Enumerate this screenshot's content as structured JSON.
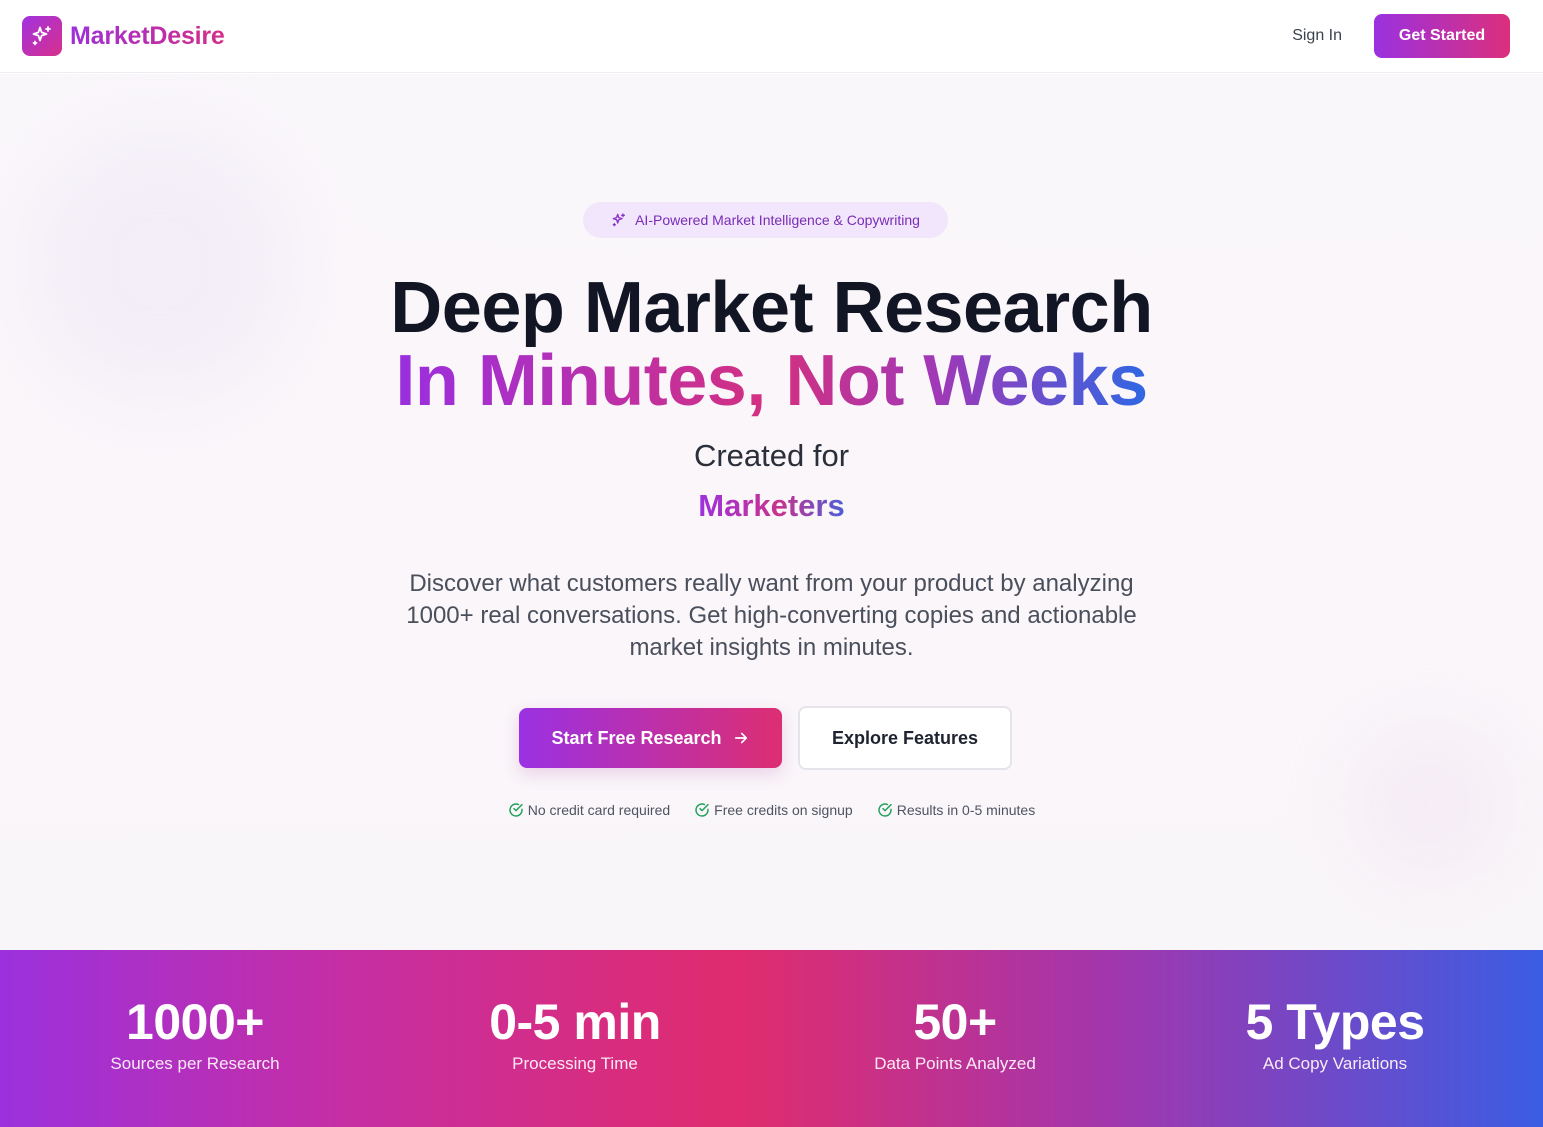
{
  "nav": {
    "brand": "MarketDesire",
    "sign_in": "Sign In",
    "get_started": "Get Started"
  },
  "hero": {
    "badge": "AI-Powered Market Intelligence & Copywriting",
    "headline_line1": "Deep Market Research",
    "headline_line2": "In Minutes, Not Weeks",
    "created_for": "Created for",
    "audience": "Marketers",
    "description": "Discover what customers really want from your product by analyzing 1000+ real conversations. Get high-converting copies and actionable market insights in minutes.",
    "primary_cta": "Start Free Research",
    "secondary_cta": "Explore Features",
    "perks": [
      "No credit card required",
      "Free credits on signup",
      "Results in 0-5 minutes"
    ]
  },
  "stats": [
    {
      "value": "1000+",
      "label": "Sources per Research"
    },
    {
      "value": "0-5 min",
      "label": "Processing Time"
    },
    {
      "value": "50+",
      "label": "Data Points Analyzed"
    },
    {
      "value": "5 Types",
      "label": "Ad Copy Variations"
    }
  ],
  "colors": {
    "brand_purple": "#9a31e0",
    "brand_pink": "#dc2f7c",
    "accent_blue": "#2f67e3",
    "check_green": "#22a05a"
  },
  "icons": {
    "logo": "sparkles-icon",
    "badge": "sparkles-icon",
    "cta": "arrow-right-icon",
    "perk": "check-circle-icon"
  }
}
